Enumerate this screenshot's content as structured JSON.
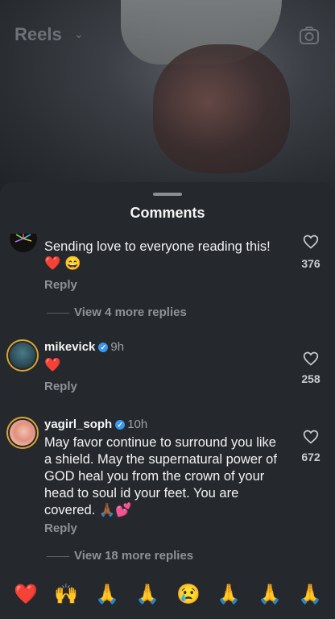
{
  "header": {
    "title": "Reels",
    "camera_icon": "camera-icon"
  },
  "sheet": {
    "title": "Comments"
  },
  "comments": [
    {
      "username": "",
      "time": "",
      "text": "Sending love to everyone reading this! ❤️ 😄",
      "reply_label": "Reply",
      "likes": "376",
      "more_replies": "View 4 more replies"
    },
    {
      "username": "mikevick",
      "time": "9h",
      "text": "❤️",
      "reply_label": "Reply",
      "likes": "258"
    },
    {
      "username": "yagirl_soph",
      "time": "10h",
      "text": "May favor continue to surround you like a shield.  May the supernatural power of GOD heal you from the crown of your head to soul id your feet.  You are covered. 🙏🏾💕",
      "reply_label": "Reply",
      "likes": "672",
      "more_replies": "View 18 more replies"
    }
  ],
  "emoji_bar": [
    "❤️",
    "🙌",
    "🙏",
    "🙏",
    "😢",
    "🙏",
    "🙏",
    "🙏"
  ],
  "colors": {
    "sheet_bg": "#25282d",
    "accent_blue": "#3897f0",
    "heart_red": "#e0263a",
    "ring_gold": "#d9a431"
  }
}
